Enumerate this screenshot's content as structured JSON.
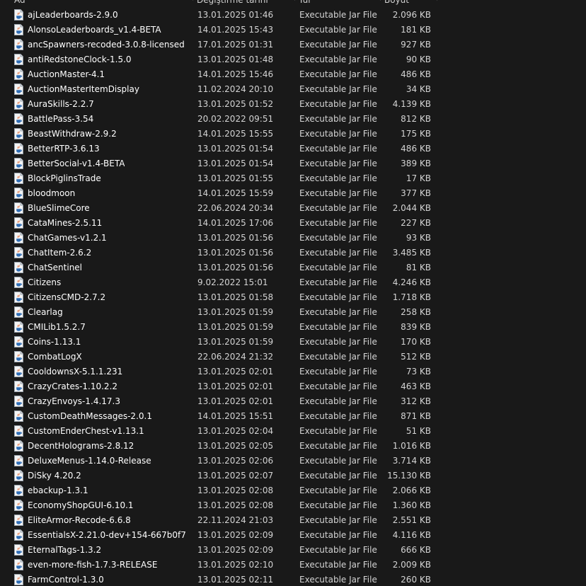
{
  "header": {
    "name": "Ad",
    "date": "Değiştirme tarihi",
    "type": "Tür",
    "size": "Boyut"
  },
  "files": [
    {
      "name": "ajLeaderboards-2.9.0",
      "date": "13.01.2025 01:46",
      "type": "Executable Jar File",
      "size": "2.096 KB"
    },
    {
      "name": "AlonsoLeaderboards_v1.4-BETA",
      "date": "14.01.2025 15:43",
      "type": "Executable Jar File",
      "size": "181 KB"
    },
    {
      "name": "ancSpawners-recoded-3.0.8-licensed",
      "date": "17.01.2025 01:31",
      "type": "Executable Jar File",
      "size": "927 KB"
    },
    {
      "name": "antiRedstoneClock-1.5.0",
      "date": "13.01.2025 01:48",
      "type": "Executable Jar File",
      "size": "90 KB"
    },
    {
      "name": "AuctionMaster-4.1",
      "date": "14.01.2025 15:46",
      "type": "Executable Jar File",
      "size": "486 KB"
    },
    {
      "name": "AuctionMasterItemDisplay",
      "date": "11.02.2024 20:10",
      "type": "Executable Jar File",
      "size": "34 KB"
    },
    {
      "name": "AuraSkills-2.2.7",
      "date": "13.01.2025 01:52",
      "type": "Executable Jar File",
      "size": "4.139 KB"
    },
    {
      "name": "BattlePass-3.54",
      "date": "20.02.2022 09:51",
      "type": "Executable Jar File",
      "size": "812 KB"
    },
    {
      "name": "BeastWithdraw-2.9.2",
      "date": "14.01.2025 15:55",
      "type": "Executable Jar File",
      "size": "175 KB"
    },
    {
      "name": "BetterRTP-3.6.13",
      "date": "13.01.2025 01:54",
      "type": "Executable Jar File",
      "size": "486 KB"
    },
    {
      "name": "BetterSocial-v1.4-BETA",
      "date": "13.01.2025 01:54",
      "type": "Executable Jar File",
      "size": "389 KB"
    },
    {
      "name": "BlockPiglinsTrade",
      "date": "13.01.2025 01:55",
      "type": "Executable Jar File",
      "size": "17 KB"
    },
    {
      "name": "bloodmoon",
      "date": "14.01.2025 15:59",
      "type": "Executable Jar File",
      "size": "377 KB"
    },
    {
      "name": "BlueSlimeCore",
      "date": "22.06.2024 20:34",
      "type": "Executable Jar File",
      "size": "2.044 KB"
    },
    {
      "name": "CataMines-2.5.11",
      "date": "14.01.2025 17:06",
      "type": "Executable Jar File",
      "size": "227 KB"
    },
    {
      "name": "ChatGames-v1.2.1",
      "date": "13.01.2025 01:56",
      "type": "Executable Jar File",
      "size": "93 KB"
    },
    {
      "name": "ChatItem-2.6.2",
      "date": "13.01.2025 01:56",
      "type": "Executable Jar File",
      "size": "3.485 KB"
    },
    {
      "name": "ChatSentinel",
      "date": "13.01.2025 01:56",
      "type": "Executable Jar File",
      "size": "81 KB"
    },
    {
      "name": "Citizens",
      "date": "9.02.2022 15:01",
      "type": "Executable Jar File",
      "size": "4.246 KB"
    },
    {
      "name": "CitizensCMD-2.7.2",
      "date": "13.01.2025 01:58",
      "type": "Executable Jar File",
      "size": "1.718 KB"
    },
    {
      "name": "Clearlag",
      "date": "13.01.2025 01:59",
      "type": "Executable Jar File",
      "size": "258 KB"
    },
    {
      "name": "CMILib1.5.2.7",
      "date": "13.01.2025 01:59",
      "type": "Executable Jar File",
      "size": "839 KB"
    },
    {
      "name": "Coins-1.13.1",
      "date": "13.01.2025 01:59",
      "type": "Executable Jar File",
      "size": "170 KB"
    },
    {
      "name": "CombatLogX",
      "date": "22.06.2024 21:32",
      "type": "Executable Jar File",
      "size": "512 KB"
    },
    {
      "name": "CooldownsX-5.1.1.231",
      "date": "13.01.2025 02:01",
      "type": "Executable Jar File",
      "size": "73 KB"
    },
    {
      "name": "CrazyCrates-1.10.2.2",
      "date": "13.01.2025 02:01",
      "type": "Executable Jar File",
      "size": "463 KB"
    },
    {
      "name": "CrazyEnvoys-1.4.17.3",
      "date": "13.01.2025 02:01",
      "type": "Executable Jar File",
      "size": "312 KB"
    },
    {
      "name": "CustomDeathMessages-2.0.1",
      "date": "14.01.2025 15:51",
      "type": "Executable Jar File",
      "size": "871 KB"
    },
    {
      "name": "CustomEnderChest-v1.13.1",
      "date": "13.01.2025 02:04",
      "type": "Executable Jar File",
      "size": "51 KB"
    },
    {
      "name": "DecentHolograms-2.8.12",
      "date": "13.01.2025 02:05",
      "type": "Executable Jar File",
      "size": "1.016 KB"
    },
    {
      "name": "DeluxeMenus-1.14.0-Release",
      "date": "13.01.2025 02:06",
      "type": "Executable Jar File",
      "size": "3.714 KB"
    },
    {
      "name": "DiSky 4.20.2",
      "date": "13.01.2025 02:07",
      "type": "Executable Jar File",
      "size": "15.130 KB"
    },
    {
      "name": "ebackup-1.3.1",
      "date": "13.01.2025 02:08",
      "type": "Executable Jar File",
      "size": "2.066 KB"
    },
    {
      "name": "EconomyShopGUI-6.10.1",
      "date": "13.01.2025 02:08",
      "type": "Executable Jar File",
      "size": "1.360 KB"
    },
    {
      "name": "EliteArmor-Recode-6.6.8",
      "date": "22.11.2024 21:03",
      "type": "Executable Jar File",
      "size": "2.551 KB"
    },
    {
      "name": "EssentialsX-2.21.0-dev+154-667b0f7",
      "date": "13.01.2025 02:09",
      "type": "Executable Jar File",
      "size": "4.116 KB"
    },
    {
      "name": "EternalTags-1.3.2",
      "date": "13.01.2025 02:09",
      "type": "Executable Jar File",
      "size": "666 KB"
    },
    {
      "name": "even-more-fish-1.7.3-RELEASE",
      "date": "13.01.2025 02:10",
      "type": "Executable Jar File",
      "size": "2.009 KB"
    },
    {
      "name": "FarmControl-1.3.0",
      "date": "13.01.2025 02:11",
      "type": "Executable Jar File",
      "size": "260 KB"
    }
  ],
  "icon": "java-jar-icon"
}
